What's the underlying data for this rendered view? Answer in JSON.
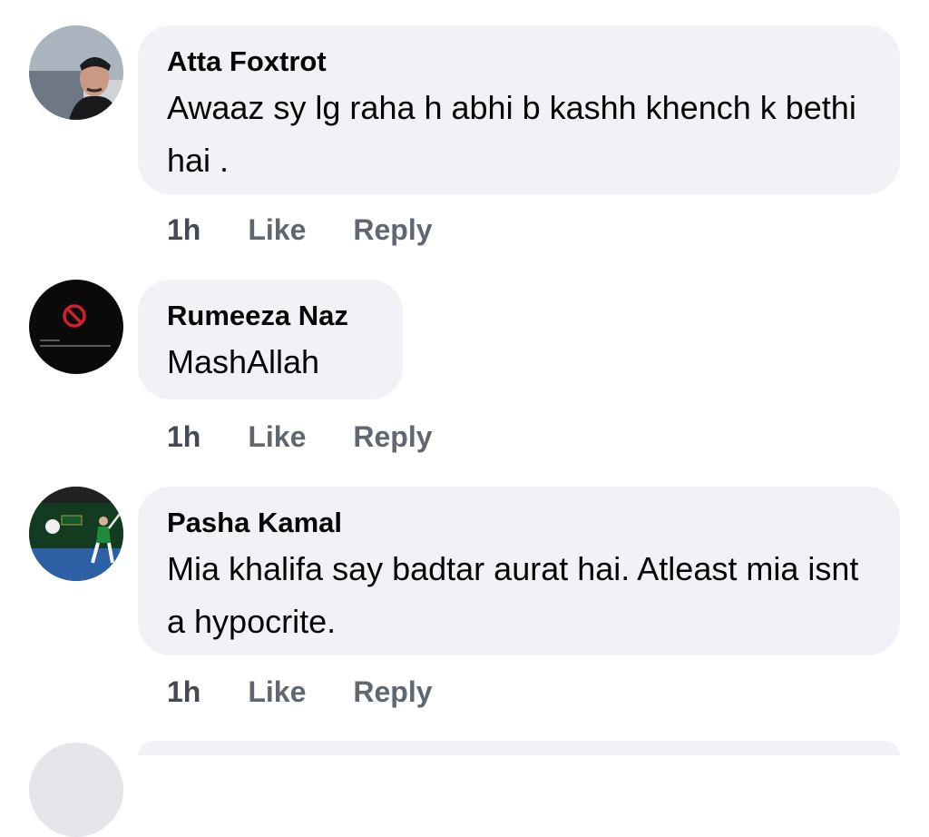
{
  "comments": [
    {
      "author": "Atta Foxtrot",
      "text": "Awaaz sy lg raha h abhi b kashh khench k bethi hai  .",
      "time": "1h",
      "like_label": "Like",
      "reply_label": "Reply"
    },
    {
      "author": "Rumeeza Naz",
      "text": "MashAllah",
      "time": "1h",
      "like_label": "Like",
      "reply_label": "Reply"
    },
    {
      "author": "Pasha Kamal",
      "text": "Mia khalifa say badtar aurat hai. Atleast mia isnt a hypocrite.",
      "time": "1h",
      "like_label": "Like",
      "reply_label": "Reply"
    }
  ],
  "colors": {
    "bubble": "#f0f2f5",
    "text": "#050505",
    "meta": "#606770"
  }
}
